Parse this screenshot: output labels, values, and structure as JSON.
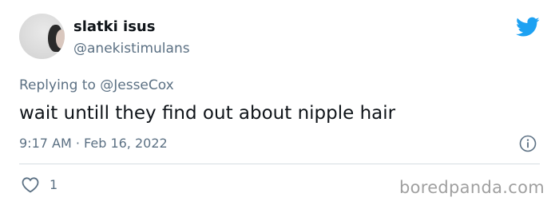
{
  "user": {
    "display_name": "slatki isus",
    "handle": "@anekistimulans"
  },
  "reply": {
    "prefix": "Replying to ",
    "mention": "@JesseCox"
  },
  "tweet": {
    "text": "wait untill they find out about nipple hair",
    "timestamp": "9:17 AM · Feb 16, 2022"
  },
  "engagement": {
    "likes": "1"
  },
  "watermark": "boredpanda.com",
  "colors": {
    "twitter_blue": "#1da1f2",
    "secondary_text": "#5b7083"
  },
  "icons": {
    "brand": "twitter-bird-icon",
    "info": "info-icon",
    "like": "heart-icon"
  }
}
